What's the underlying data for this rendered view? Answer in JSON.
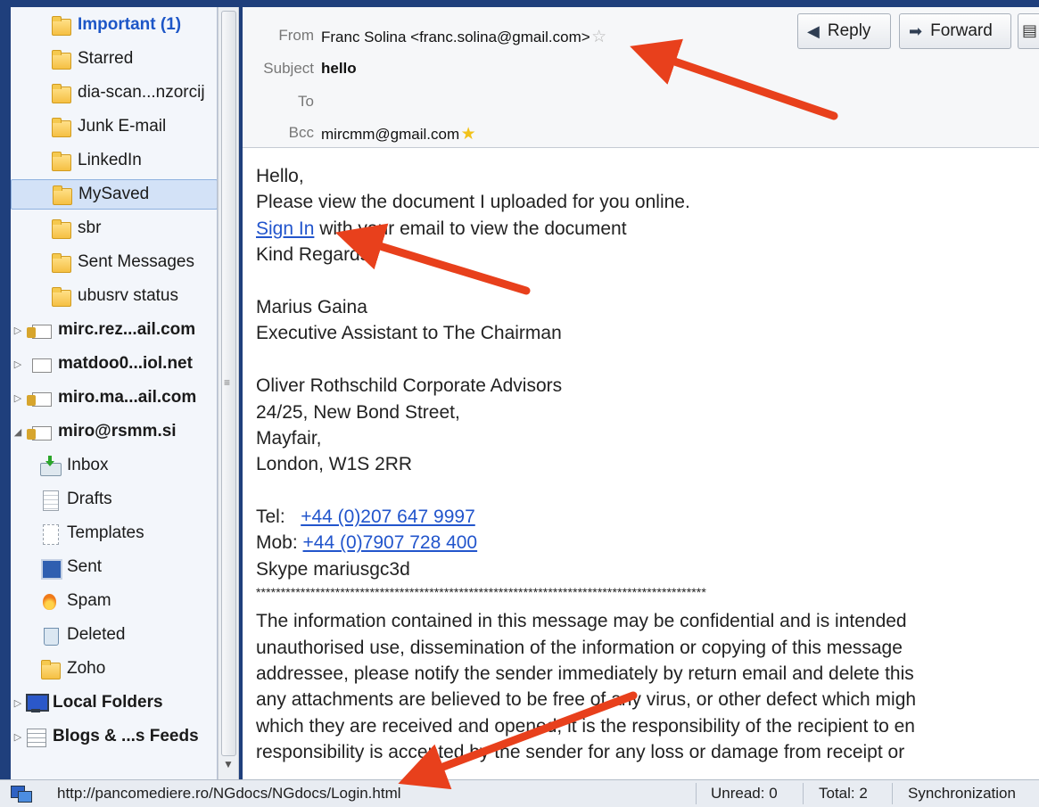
{
  "folders": [
    {
      "label": "Important (1)",
      "icon": "folder-icon",
      "style": "unread",
      "twisty": ""
    },
    {
      "label": "Starred",
      "icon": "folder-icon",
      "style": "",
      "twisty": ""
    },
    {
      "label": "dia-scan...nzorcij",
      "icon": "folder-icon",
      "style": "",
      "twisty": ""
    },
    {
      "label": "Junk E-mail",
      "icon": "folder-icon",
      "style": "",
      "twisty": ""
    },
    {
      "label": "LinkedIn",
      "icon": "folder-icon",
      "style": "",
      "twisty": ""
    },
    {
      "label": "MySaved",
      "icon": "folder-icon",
      "style": "selected",
      "twisty": ""
    },
    {
      "label": "sbr",
      "icon": "folder-icon",
      "style": "",
      "twisty": ""
    },
    {
      "label": "Sent Messages",
      "icon": "folder-icon",
      "style": "",
      "twisty": ""
    },
    {
      "label": "ubusrv status",
      "icon": "folder-icon",
      "style": "",
      "twisty": ""
    },
    {
      "label": "mirc.rez...ail.com",
      "icon": "account-icon",
      "style": "bold",
      "twisty": "▷"
    },
    {
      "label": "matdoo0...iol.net",
      "icon": "account-plain-icon",
      "style": "bold",
      "twisty": "▷"
    },
    {
      "label": "miro.ma...ail.com",
      "icon": "account-icon",
      "style": "bold",
      "twisty": "▷"
    },
    {
      "label": "miro@rsmm.si",
      "icon": "account-icon",
      "style": "bold",
      "twisty": "◢"
    },
    {
      "label": "Inbox",
      "icon": "inbox-icon",
      "style": "",
      "twisty": ""
    },
    {
      "label": "Drafts",
      "icon": "drafts-icon",
      "style": "",
      "twisty": ""
    },
    {
      "label": "Templates",
      "icon": "templates-icon",
      "style": "",
      "twisty": ""
    },
    {
      "label": "Sent",
      "icon": "sent-icon",
      "style": "",
      "twisty": ""
    },
    {
      "label": "Spam",
      "icon": "spam-icon",
      "style": "",
      "twisty": ""
    },
    {
      "label": "Deleted",
      "icon": "trash-icon",
      "style": "",
      "twisty": ""
    },
    {
      "label": "Zoho",
      "icon": "folder-icon",
      "style": "",
      "twisty": ""
    },
    {
      "label": "Local Folders",
      "icon": "monitor-icon",
      "style": "bold",
      "twisty": "▷"
    },
    {
      "label": "Blogs & ...s Feeds",
      "icon": "feed-icon",
      "style": "bold",
      "twisty": "▷"
    }
  ],
  "header": {
    "from_label": "From",
    "from_value": "Franc Solina <franc.solina@gmail.com>",
    "subject_label": "Subject",
    "subject_value": "hello",
    "to_label": "To",
    "to_value": "",
    "bcc_label": "Bcc",
    "bcc_value": "mircmm@gmail.com",
    "reply_label": "Reply",
    "forward_label": "Forward"
  },
  "body": {
    "greeting": "Hello,",
    "line1": "Please view the document I uploaded for you online.",
    "signin_link": "Sign In",
    "signin_rest": " with your email to view the document",
    "regards": "Kind Regards,",
    "sig_name": "Marius Gaina",
    "sig_title": "Executive Assistant to The Chairman",
    "company": "Oliver Rothschild Corporate Advisors",
    "addr1": "24/25, New Bond Street,",
    "addr2": "Mayfair,",
    "addr3": "London,  W1S 2RR",
    "tel_label": "Tel:   ",
    "tel_value": "+44 (0)207 647 9997",
    "mob_label": "Mob: ",
    "mob_value": "+44 (0)7907 728 400",
    "skype": "Skype mariusgc3d",
    "divider": "*******************************************************************************************",
    "disclaimer": [
      "The information contained in this message may be confidential and is intended",
      "unauthorised use, dissemination of the information or copying of this message",
      "addressee, please notify the sender immediately by return email and delete this",
      "any attachments are believed to be free of any virus, or other defect which migh",
      "which they are received and opened, it is the responsibility of the recipient to en",
      "responsibility is accepted by the sender for any loss or damage from receipt or"
    ]
  },
  "status": {
    "url": "http://pancomediere.ro/NGdocs/NGdocs/Login.html",
    "unread": "Unread: 0",
    "total": "Total: 2",
    "sync": "Synchronization"
  },
  "colors": {
    "annotation_arrow": "#e8401c",
    "link": "#2255cc",
    "accent": "#1d56c7"
  }
}
